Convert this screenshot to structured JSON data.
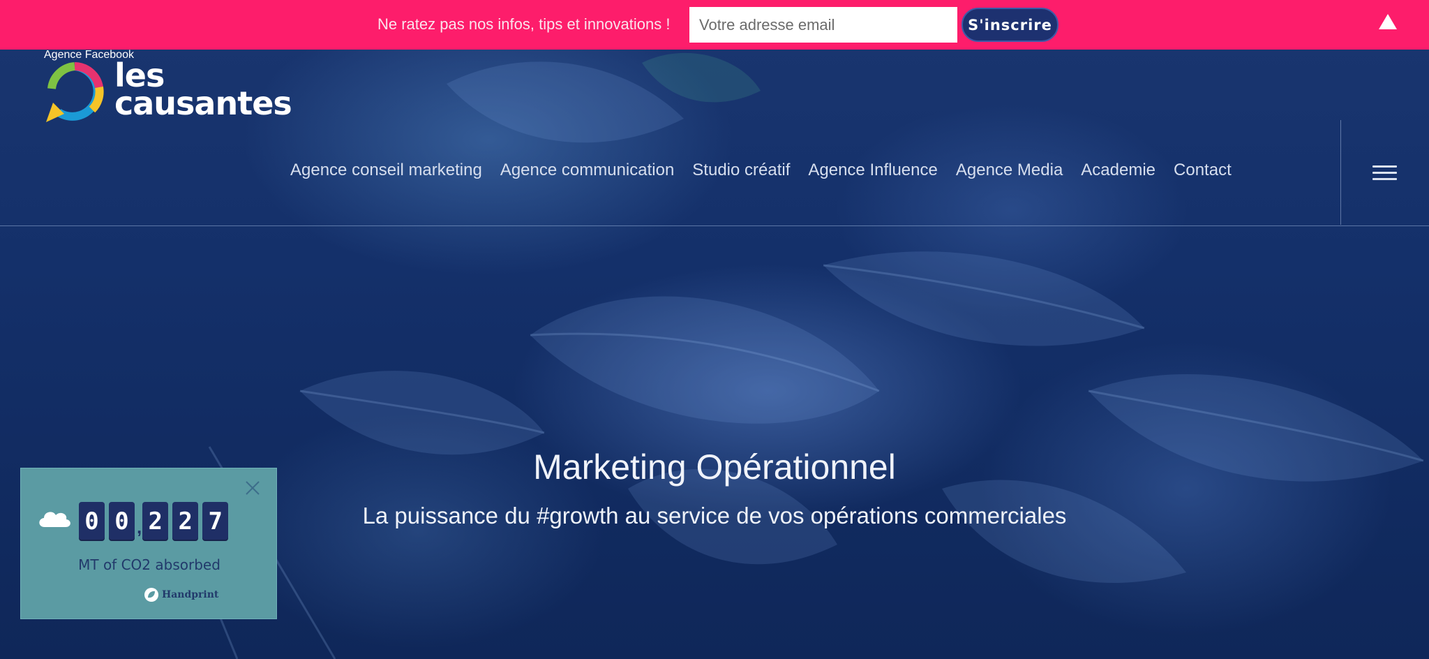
{
  "banner": {
    "message": "Ne ratez pas nos infos, tips et innovations !",
    "email_placeholder": "Votre adresse email",
    "subscribe_label": "S'inscrire"
  },
  "logo": {
    "tagline": "Agence Facebook",
    "brand_line1": "les",
    "brand_line2": "causantes"
  },
  "nav": {
    "items": [
      "Agence conseil marketing",
      "Agence communication",
      "Studio créatif",
      "Agence Influence",
      "Agence Media",
      "Academie",
      "Contact"
    ]
  },
  "hero": {
    "title": "Marketing Opérationnel",
    "subtitle": "La puissance du #growth au service de vos opérations commerciales"
  },
  "co2_widget": {
    "digits": [
      "0",
      "0",
      "2",
      "2",
      "7"
    ],
    "separator": ",",
    "label": "MT of CO2 absorbed",
    "brand": "Handprint"
  },
  "colors": {
    "banner": "#fd1d6b",
    "button": "#1d3170",
    "widget": "#5b9ba3",
    "overlay": "#14306a"
  }
}
